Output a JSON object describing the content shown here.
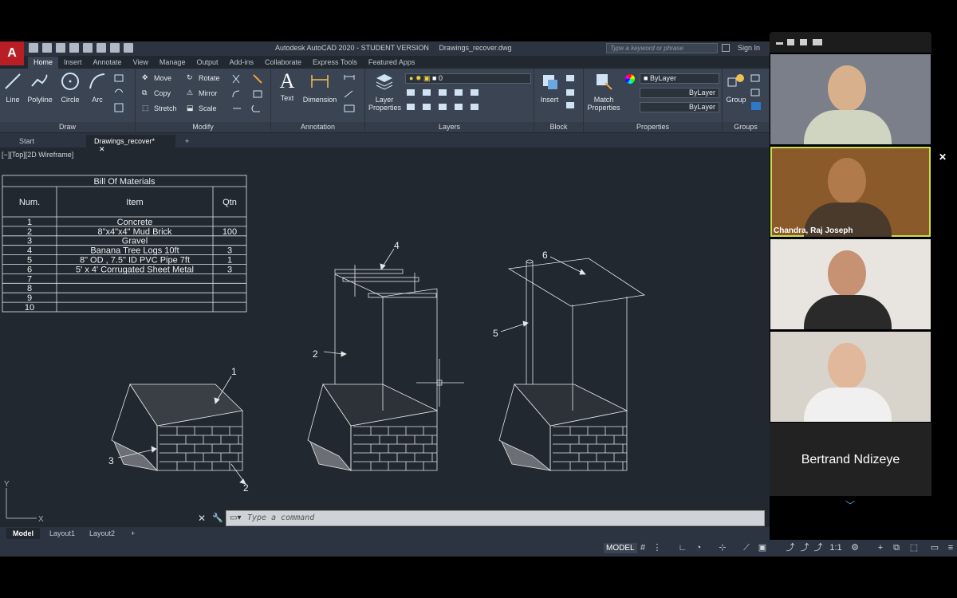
{
  "app": {
    "name": "Autodesk AutoCAD 2020 - STUDENT VERSION",
    "file": "Drawings_recover.dwg",
    "logo": "A",
    "search_placeholder": "Type a keyword or phrase",
    "sign_in": "Sign In"
  },
  "ribbon_tabs": [
    "Home",
    "Insert",
    "Annotate",
    "View",
    "Manage",
    "Output",
    "Add-ins",
    "Collaborate",
    "Express Tools",
    "Featured Apps"
  ],
  "ribbon": {
    "draw": {
      "title": "Draw",
      "line": "Line",
      "polyline": "Polyline",
      "circle": "Circle",
      "arc": "Arc"
    },
    "modify": {
      "title": "Modify",
      "move": "Move",
      "copy": "Copy",
      "stretch": "Stretch",
      "rotate": "Rotate",
      "mirror": "Mirror",
      "scale": "Scale"
    },
    "annotation": {
      "title": "Annotation",
      "text": "Text",
      "dimension": "Dimension"
    },
    "layers": {
      "title": "Layers",
      "layer_properties": "Layer Properties",
      "current_layer": "0"
    },
    "block": {
      "title": "Block",
      "insert": "Insert"
    },
    "properties": {
      "title": "Properties",
      "match": "Match Properties",
      "color": "ByLayer",
      "linetype": "ByLayer",
      "lineweight": "ByLayer"
    },
    "groups": {
      "title": "Groups",
      "group": "Group"
    }
  },
  "file_tabs": {
    "start": "Start",
    "drawing": "Drawings_recover*"
  },
  "viewport_label": "[−][Top][2D Wireframe]",
  "bom": {
    "title": "Bill Of Materials",
    "headers": [
      "Num.",
      "Item",
      "Qtn"
    ],
    "rows": [
      [
        "1",
        "Concrete",
        ""
      ],
      [
        "2",
        "8\"x4\"x4\" Mud Brick",
        "100"
      ],
      [
        "3",
        "Gravel",
        ""
      ],
      [
        "4",
        "Banana Tree Logs 10ft",
        "3"
      ],
      [
        "5",
        "8\" OD , 7.5\" ID PVC Pipe 7ft",
        "1"
      ],
      [
        "6",
        "5' x 4' Corrugated Sheet Metal",
        "3"
      ],
      [
        "7",
        "",
        ""
      ],
      [
        "8",
        "",
        ""
      ],
      [
        "9",
        "",
        ""
      ],
      [
        "10",
        "",
        ""
      ]
    ]
  },
  "callouts": {
    "c1": "1",
    "c2a": "2",
    "c2b": "2",
    "c3": "3",
    "c4": "4",
    "c5": "5",
    "c6": "6"
  },
  "axis": {
    "x": "X",
    "y": "Y"
  },
  "command": {
    "placeholder": "Type a command"
  },
  "layout_tabs": [
    "Model",
    "Layout1",
    "Layout2"
  ],
  "status": {
    "model": "MODEL",
    "scale": "1:1"
  },
  "zoom": {
    "participants": [
      {
        "name": "",
        "shirt": "#cfd5c0",
        "skin": "#d9b08c",
        "bg": "#7b7f8a"
      },
      {
        "name": "Chandra, Raj Joseph",
        "shirt": "#4a3a2c",
        "skin": "#b07a4a",
        "bg": "#8a5a2a"
      },
      {
        "name": "",
        "shirt": "#2a2a2a",
        "skin": "#c79274",
        "bg": "#e8e4e0"
      },
      {
        "name": "",
        "shirt": "#f0f0f0",
        "skin": "#e2b89c",
        "bg": "#d8d4cc"
      }
    ],
    "featured_name": "Bertrand Ndizeye"
  },
  "colors": {
    "canvas": "#212830",
    "ribbon": "#3a4452",
    "accent": "#c8e04a",
    "autocad_red": "#b81e24"
  }
}
